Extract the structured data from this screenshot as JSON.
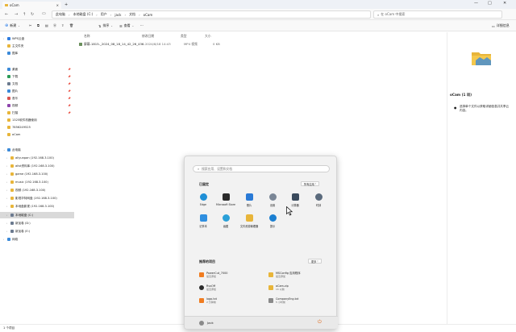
{
  "window": {
    "tab_title": "oCam",
    "tab_close": "×",
    "new_tab": "+",
    "controls": {
      "minimize": "—",
      "maximize": "□",
      "close": "✕"
    }
  },
  "address": {
    "crumbs": [
      "此电脑",
      "本地磁盘 (C:)",
      "用户",
      "jack",
      "文档",
      "oCam"
    ],
    "search_placeholder": "在 oCam 中搜索"
  },
  "commandbar": {
    "new_label": "新建",
    "sort_label": "排序",
    "view_label": "查看",
    "more": "···",
    "details_label": "详细信息"
  },
  "columns": {
    "name": "名称",
    "date": "修改日期",
    "type": "类型",
    "size": "大小"
  },
  "files": [
    {
      "name": "屏幕-1815-_2024_08_18_14_42_26_436...",
      "date": "2024/8/18 14:43",
      "type": "MP4 视频",
      "size": "0 KB"
    }
  ],
  "sidebar": {
    "top": [
      {
        "label": "WPS云盘",
        "color": "#2f7de1"
      },
      {
        "label": "主文件夹",
        "color": "#e8b53a"
      },
      {
        "label": "图库",
        "color": "#3b8ad9"
      }
    ],
    "quick": [
      {
        "label": "桌面",
        "color": "#3b8ad9"
      },
      {
        "label": "下载",
        "color": "#2b9a57"
      },
      {
        "label": "文档",
        "color": "#6b7a8f"
      },
      {
        "label": "图片",
        "color": "#3b8ad9"
      },
      {
        "label": "音乐",
        "color": "#d9534f"
      },
      {
        "label": "视频",
        "color": "#8e44ad"
      },
      {
        "label": "扫描",
        "color": "#e8b53a"
      },
      {
        "label": "1325软件机器使用",
        "color": "#e8b53a"
      },
      {
        "label": "7856249525",
        "color": "#e8b53a"
      },
      {
        "label": "oCam",
        "color": "#e8b53a"
      }
    ],
    "this_pc": "此电脑",
    "drives": [
      {
        "label": "aliyunpan (192.168.3.100)",
        "color": "#e8b53a",
        "selected": false
      },
      {
        "label": "alist资料库 (192.168.3.100)",
        "color": "#e8b53a",
        "selected": false
      },
      {
        "label": "game (192.168.3.100)",
        "color": "#e8b53a",
        "selected": false
      },
      {
        "label": "music (192.168.3.100)",
        "color": "#e8b53a",
        "selected": false
      },
      {
        "label": "视频 (192.168.3.100)",
        "color": "#e8b53a",
        "selected": false
      },
      {
        "label": "影视华特网盘 (192.168.3.100)",
        "color": "#e8b53a",
        "selected": false
      },
      {
        "label": "本地盘影视 (192.168.3.100)",
        "color": "#e8b53a",
        "selected": false
      },
      {
        "label": "本地磁盘 (C:)",
        "color": "#6b7a8f",
        "selected": true
      },
      {
        "label": "新加卷 (D:)",
        "color": "#6b7a8f",
        "selected": false
      },
      {
        "label": "新加卷 (E:)",
        "color": "#6b7a8f",
        "selected": false
      }
    ],
    "network": "网络"
  },
  "details": {
    "title": "oCam (1 项)",
    "info": "选择单个文件以获取详细信息并共享云内容。"
  },
  "statusbar": {
    "items": "1 个项目"
  },
  "startmenu": {
    "search_placeholder": "搜索应用、设置和文档",
    "pinned_title": "已固定",
    "all_apps": "所有应用",
    "pinned": [
      {
        "label": "Edge",
        "color": "#1f8fd6"
      },
      {
        "label": "Microsoft Store",
        "color": "#2b2b2b"
      },
      {
        "label": "照片",
        "color": "#2a7ad6"
      },
      {
        "label": "设置",
        "color": "#7a8696"
      },
      {
        "label": "计算器",
        "color": "#3a4a5c"
      },
      {
        "label": "时钟",
        "color": "#5a6a7c"
      },
      {
        "label": "记事本",
        "color": "#2f8fe0"
      },
      {
        "label": "画图",
        "color": "#2aa0d8"
      },
      {
        "label": "文件资源管理器",
        "color": "#e8b53a"
      },
      {
        "label": "提示",
        "color": "#1b7fd1"
      }
    ],
    "recommended_title": "推荐的项目",
    "more": "更多",
    "recommended": [
      {
        "name": "PowerCut_7000",
        "sub": "最近添加",
        "color": "#f07c20"
      },
      {
        "name": "MSConfig 应用程序",
        "sub": "最近添加",
        "color": "#e8b53a"
      },
      {
        "name": "RvsOff",
        "sub": "最近添加",
        "color": "#2b2b2b"
      },
      {
        "name": "oCam.zip",
        "sub": "1h 以前",
        "color": "#e8b53a"
      },
      {
        "name": "logo.txt",
        "sub": "2 分钟前",
        "color": "#f07c20"
      },
      {
        "name": "CompanyEng.txt",
        "sub": "5 小时前",
        "color": "#8a8a8a"
      }
    ],
    "user": "Jack",
    "power": "⏻"
  }
}
